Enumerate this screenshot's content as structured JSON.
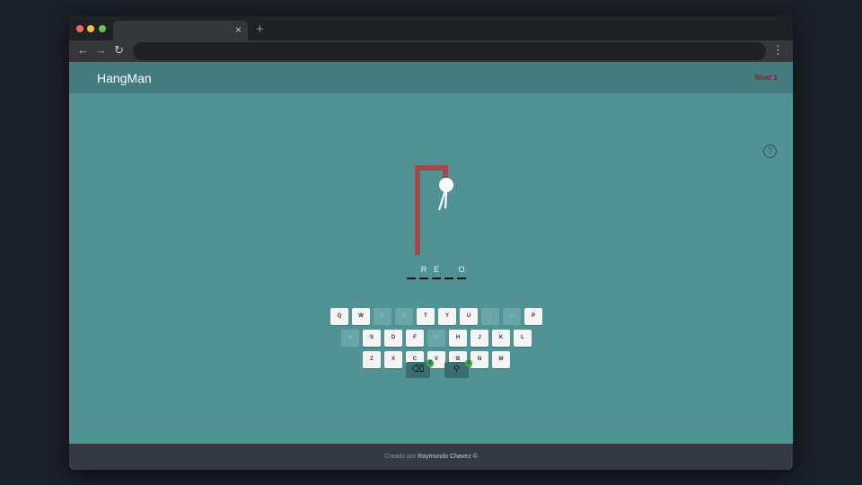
{
  "browser": {
    "tab_close_glyph": "×",
    "new_tab_glyph": "+",
    "back_glyph": "←",
    "forward_glyph": "→",
    "reload_glyph": "↻",
    "menu_glyph": "⋮"
  },
  "app": {
    "title": "HangMan",
    "level": "Nivel 1",
    "help_glyph": "?"
  },
  "word": {
    "slots": [
      "",
      "R",
      "E",
      "",
      "O"
    ]
  },
  "keyboard": {
    "rows": [
      [
        {
          "letter": "Q",
          "used": false
        },
        {
          "letter": "W",
          "used": false
        },
        {
          "letter": "E",
          "used": true
        },
        {
          "letter": "R",
          "used": true
        },
        {
          "letter": "T",
          "used": false
        },
        {
          "letter": "Y",
          "used": false
        },
        {
          "letter": "U",
          "used": false
        },
        {
          "letter": "I",
          "used": true
        },
        {
          "letter": "O",
          "used": true
        },
        {
          "letter": "P",
          "used": false
        }
      ],
      [
        {
          "letter": "A",
          "used": true
        },
        {
          "letter": "S",
          "used": false
        },
        {
          "letter": "D",
          "used": false
        },
        {
          "letter": "F",
          "used": false
        },
        {
          "letter": "G",
          "used": true
        },
        {
          "letter": "H",
          "used": false
        },
        {
          "letter": "J",
          "used": false
        },
        {
          "letter": "K",
          "used": false
        },
        {
          "letter": "L",
          "used": false
        }
      ],
      [
        {
          "letter": "Z",
          "used": false
        },
        {
          "letter": "X",
          "used": false
        },
        {
          "letter": "C",
          "used": false
        },
        {
          "letter": "V",
          "used": false
        },
        {
          "letter": "B",
          "used": false
        },
        {
          "letter": "N",
          "used": false
        },
        {
          "letter": "M",
          "used": false
        }
      ]
    ]
  },
  "powerups": {
    "eraser": {
      "icon": "eraser-icon",
      "glyph": "⌫",
      "count": "2"
    },
    "hint": {
      "icon": "magnifier-icon",
      "glyph": "⚲",
      "count": "1"
    }
  },
  "footer": {
    "prefix": "Creado por",
    "author": "Raymundo Chavez ©"
  },
  "colors": {
    "page_bg": "#519294",
    "header_bg": "#437b7e",
    "gallows": "#a14a4a",
    "level_text": "#8b2424",
    "footer_bg": "#343a40"
  }
}
